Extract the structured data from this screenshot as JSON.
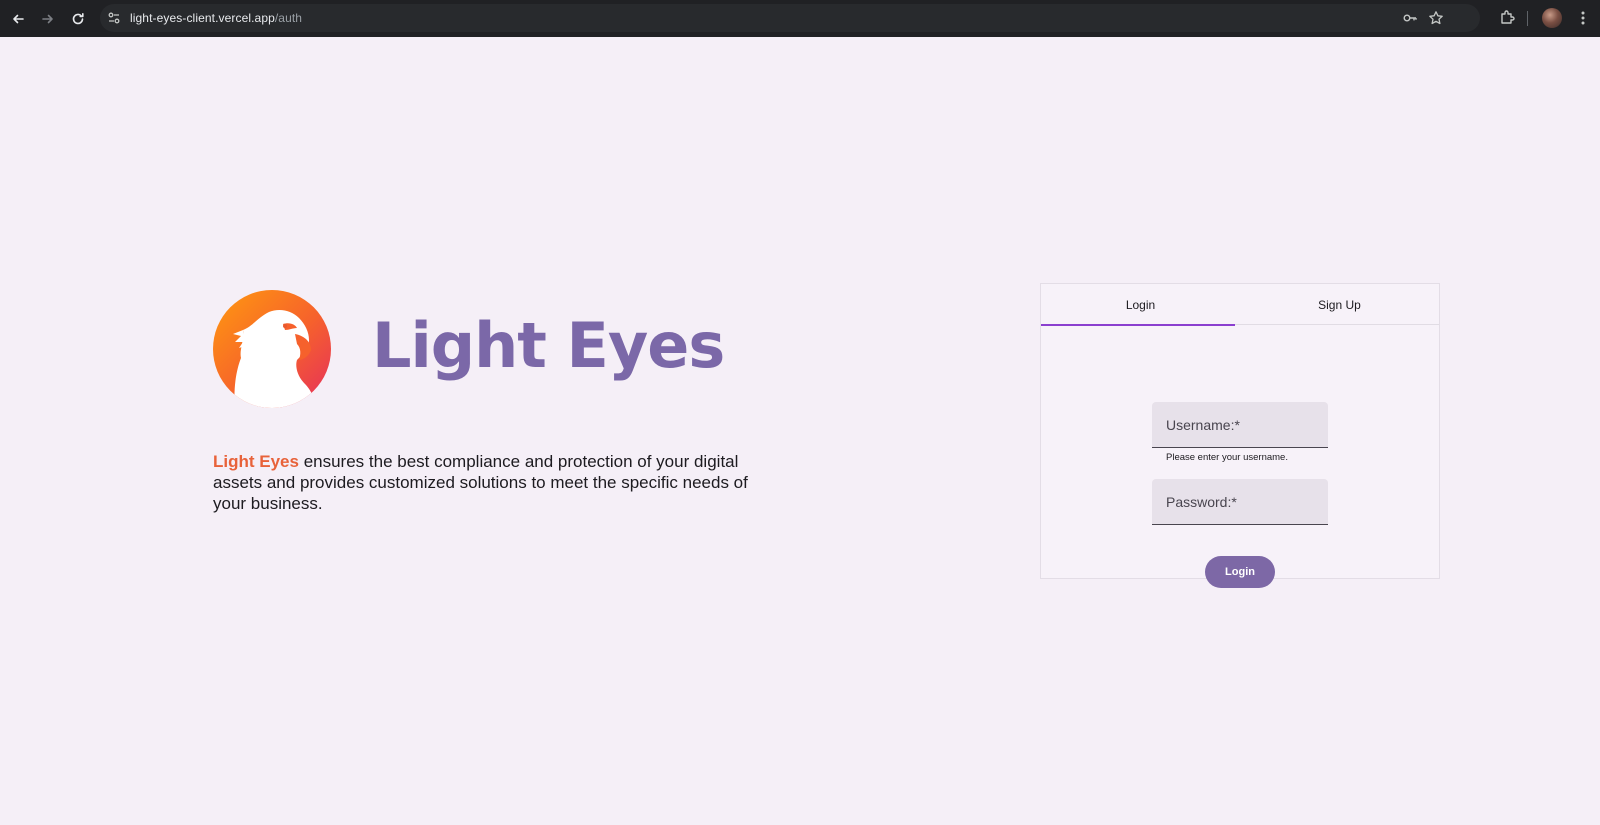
{
  "browser": {
    "url_host": "light-eyes-client.vercel.app",
    "url_path": "/auth"
  },
  "brand": {
    "name": "Light Eyes",
    "logo": "eagle-logo-icon",
    "accent_color": "#7b68a8",
    "highlight_color": "#e8623a"
  },
  "tagline": {
    "highlight": "Light Eyes",
    "text": " ensures the best compliance and protection of your digital assets and provides customized solutions to meet the specific needs of your business."
  },
  "auth": {
    "tabs": [
      {
        "label": "Login",
        "active": true
      },
      {
        "label": "Sign Up",
        "active": false
      }
    ],
    "username": {
      "label": "Username:*",
      "hint": "Please enter your username.",
      "value": ""
    },
    "password": {
      "label": "Password:*",
      "value": ""
    },
    "submit_label": "Login"
  }
}
